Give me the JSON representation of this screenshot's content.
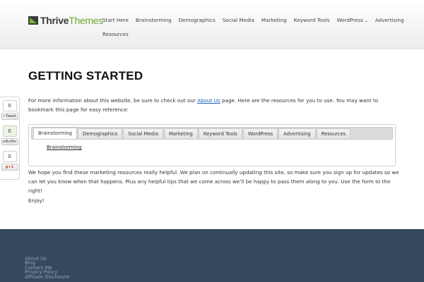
{
  "header": {
    "logo": {
      "part1": "Thrive",
      "part2": "Themes"
    },
    "nav_row1": [
      "Start Here",
      "Brainstorming",
      "Demographics",
      "Social Media",
      "Marketing",
      "Keyword Tools",
      "WordPress",
      "Advertising"
    ],
    "nav_row2": [
      "Resources"
    ]
  },
  "page": {
    "title": "GETTING STARTED",
    "intro_before": "For more information about this website, be sure to check out our ",
    "intro_link": "About Us",
    "intro_after": " page.  Here are the resources for you to use.  You may want to bookmark this page for easy reference:",
    "tabs": [
      "Brainstorming",
      "Demographics",
      "Social Media",
      "Marketing",
      "Keyword Tools",
      "WordPress",
      "Advertising",
      "Resources"
    ],
    "active_tab": "Brainstorming",
    "tab_content_link": "Brainstorming",
    "body": "We hope you find these marketing resources really helpful.   We plan on continually updating this site, so make sure you sign up for updates so we can let you know when that happens.  Plus any helpful tips that we come across we'll be happy to pass them along to you.  Use the form to the right!",
    "enjoy": "Enjoy!"
  },
  "share": {
    "count_top": "0",
    "tweet_label": "Tweet",
    "count_green": "0",
    "buffer_label": "Buffer",
    "count_bottom": "0",
    "gplus_label": "g+1"
  },
  "footer": {
    "links": [
      "About Us",
      "Blog",
      "Contact Me",
      "Privacy Policy",
      "Affiliate Disclosure"
    ]
  },
  "colors": {
    "footer_bg": "#34495e",
    "logo_green": "#6aa632",
    "link_blue": "#1a5fb4"
  }
}
